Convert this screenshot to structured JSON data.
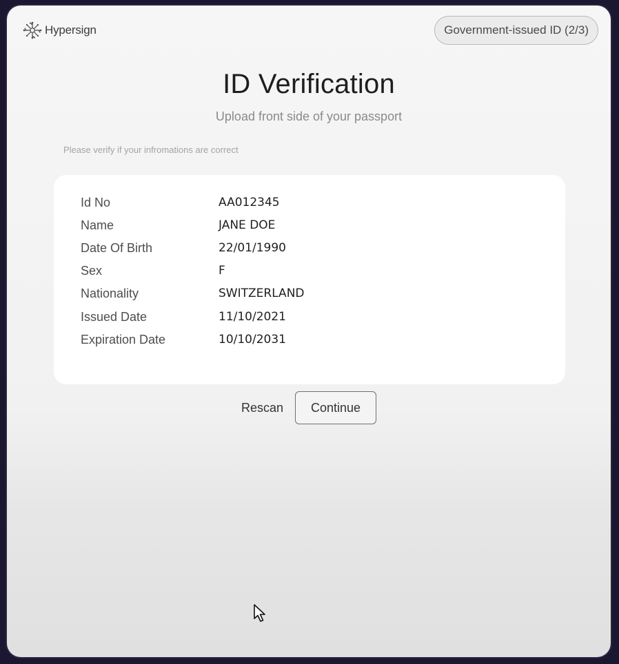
{
  "brand": {
    "name": "Hypersign",
    "logo_icon": "hypersign-logo-icon"
  },
  "step_badge": "Government-issued ID (2/3)",
  "title": "ID Verification",
  "subtitle": "Upload front side of your passport",
  "hint": "Please verify if your infromations are correct",
  "details": [
    {
      "label": "Id No",
      "value": "AA012345"
    },
    {
      "label": "Name",
      "value": "JANE DOE"
    },
    {
      "label": "Date Of Birth",
      "value": "22/01/1990"
    },
    {
      "label": "Sex",
      "value": "F"
    },
    {
      "label": "Nationality",
      "value": "SWITZERLAND"
    },
    {
      "label": "Issued Date",
      "value": "11/10/2021"
    },
    {
      "label": "Expiration Date",
      "value": "10/10/2031"
    }
  ],
  "actions": {
    "rescan": "Rescan",
    "continue": "Continue"
  },
  "colors": {
    "background": "#1b1730",
    "panel": "#f3f3f3",
    "card": "#ffffff"
  }
}
